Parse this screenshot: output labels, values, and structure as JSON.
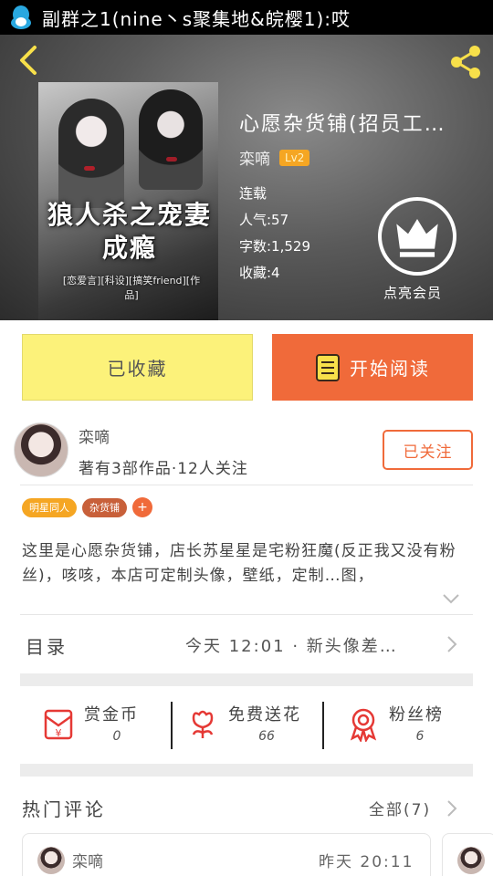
{
  "status_bar": {
    "notification": "副群之1(nine丶s聚集地&皖樱1):哎"
  },
  "book": {
    "title": "心愿杂货铺(招员工…",
    "author": "栾嘀",
    "author_level": "Lv2",
    "status": "连载",
    "popularity": "人气:57",
    "word_count": "字数:1,529",
    "favorites": "收藏:4",
    "vip_label": "点亮会员",
    "cover_title": "狼人杀之宠妻成瘾",
    "cover_subtitle": "[恋爱言][科设][搞笑friend][作品]"
  },
  "actions": {
    "favorited_label": "已收藏",
    "read_label": "开始阅读"
  },
  "author_card": {
    "name": "栾嘀",
    "stats": "著有3部作品·12人关注",
    "follow_label": "已关注"
  },
  "tags": [
    {
      "label": "明星同人",
      "color": "#f5a623"
    },
    {
      "label": "杂货铺",
      "color": "#c8603a"
    }
  ],
  "description": "这里是心愿杂货铺，店长苏星星是宅粉狂魔(反正我又没有粉丝)，咳咳，本店可定制头像，壁纸，定制…图，",
  "catalog": {
    "label": "目录",
    "latest": "今天 12:01 · 新头像差…"
  },
  "stats": [
    {
      "title": "赏金币",
      "value": "0",
      "icon": "red-envelope-icon"
    },
    {
      "title": "免费送花",
      "value": "66",
      "icon": "flower-icon"
    },
    {
      "title": "粉丝榜",
      "value": "6",
      "icon": "medal-icon"
    }
  ],
  "comments": {
    "title": "热门评论",
    "all_label": "全部(7)",
    "items": [
      {
        "name": "栾嘀",
        "time": "昨天 20:11"
      }
    ]
  },
  "colors": {
    "accent": "#f06a3a",
    "favorite_button": "#fcf27a",
    "level_badge": "#f5a623"
  }
}
